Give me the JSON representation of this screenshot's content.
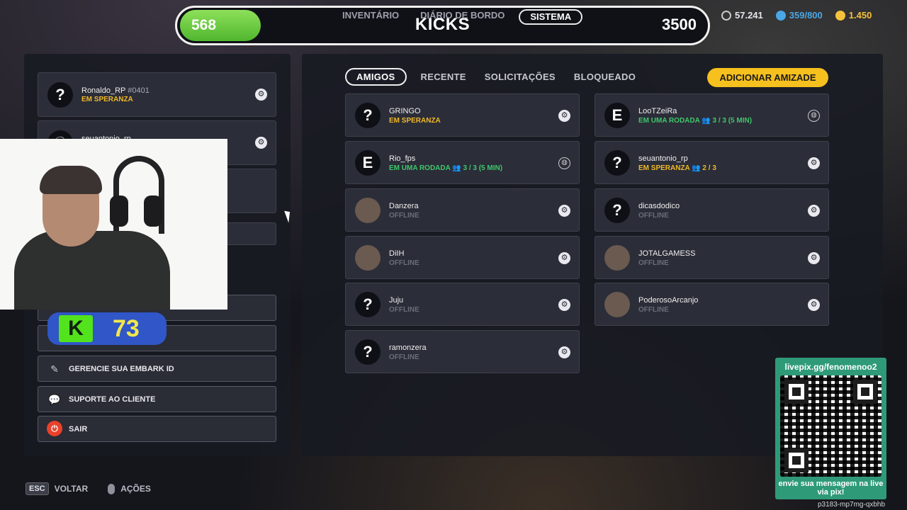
{
  "topbar": {
    "kicks_value": "568",
    "title": "KICKS",
    "target": "3500",
    "nav": [
      "INVENTÁRIO",
      "DIÁRIO DE BORDO",
      "SISTEMA"
    ],
    "active_nav": "SISTEMA"
  },
  "currencies": [
    {
      "icon": "credits-icon",
      "value": "57.241",
      "color": "#c9c9c9"
    },
    {
      "icon": "token-icon",
      "value": "359/800",
      "color": "#4aa7e6"
    },
    {
      "icon": "multiples-icon",
      "value": "1.450",
      "color": "#f5c23a"
    }
  ],
  "profile": {
    "name": "Ronaldo_RP",
    "tag": "#0401",
    "status": "EM SPERANZA"
  },
  "second_profile": {
    "name": "seuantonio_rp"
  },
  "menu": [
    {
      "label": "GERENCIE SUA EMBARK ID",
      "icon": "edit-id-icon"
    },
    {
      "label": "SUPORTE AO CLIENTE",
      "icon": "support-chat-icon"
    },
    {
      "label": "SAIR",
      "icon": "power-icon"
    }
  ],
  "tabs": [
    "AMIGOS",
    "RECENTE",
    "SOLICITAÇÕES",
    "BLOQUEADO"
  ],
  "add_friend": "ADICIONAR AMIZADE",
  "friends": [
    {
      "name": "GRINGO",
      "status": "EM SPERANZA",
      "state": "yellow",
      "avatar": "?",
      "platform": "steam"
    },
    {
      "name": "LooTZeiRa",
      "status": "EM UMA RODADA  👥 3 / 3 (5 MIN)",
      "state": "green",
      "avatar": "E",
      "platform": "globe"
    },
    {
      "name": "Rio_fps",
      "status": "EM UMA RODADA  👥 3 / 3 (5 MIN)",
      "state": "green",
      "avatar": "E",
      "platform": "globe"
    },
    {
      "name": "seuantonio_rp",
      "status": "EM SPERANZA  👥 2 / 3",
      "state": "yellow",
      "avatar": "?",
      "platform": "steam"
    },
    {
      "name": "Danzera",
      "status": "OFFLINE",
      "state": "offline",
      "avatar": "photo",
      "platform": "steam"
    },
    {
      "name": "dicasdodico",
      "status": "OFFLINE",
      "state": "offline",
      "avatar": "?",
      "platform": "steam"
    },
    {
      "name": "DiIH",
      "status": "OFFLINE",
      "state": "offline",
      "avatar": "photo",
      "platform": "steam"
    },
    {
      "name": "JOTALGAMESS",
      "status": "OFFLINE",
      "state": "offline",
      "avatar": "photo",
      "platform": "steam"
    },
    {
      "name": "Juju",
      "status": "OFFLINE",
      "state": "offline",
      "avatar": "?",
      "platform": "steam"
    },
    {
      "name": "PoderosoArcanjo",
      "status": "OFFLINE",
      "state": "offline",
      "avatar": "photo",
      "platform": "steam"
    },
    {
      "name": "ramonzera",
      "status": "OFFLINE",
      "state": "offline",
      "avatar": "?",
      "platform": "steam"
    }
  ],
  "overlay": {
    "kick_count": "73",
    "qr_url": "livepix.gg/fenomenoo2",
    "qr_message": "envie sua mensagem na live via pix!",
    "stream_code": "p3183-mp7mg-qxbhb"
  },
  "footer": {
    "esc_key": "ESC",
    "back_label": "VOLTAR",
    "actions_label": "AÇÕES"
  },
  "colors": {
    "accent_yellow": "#f6c01e",
    "status_green": "#3fc76a",
    "status_yellow": "#f1b928",
    "kicks_green": "#4fb62e"
  }
}
